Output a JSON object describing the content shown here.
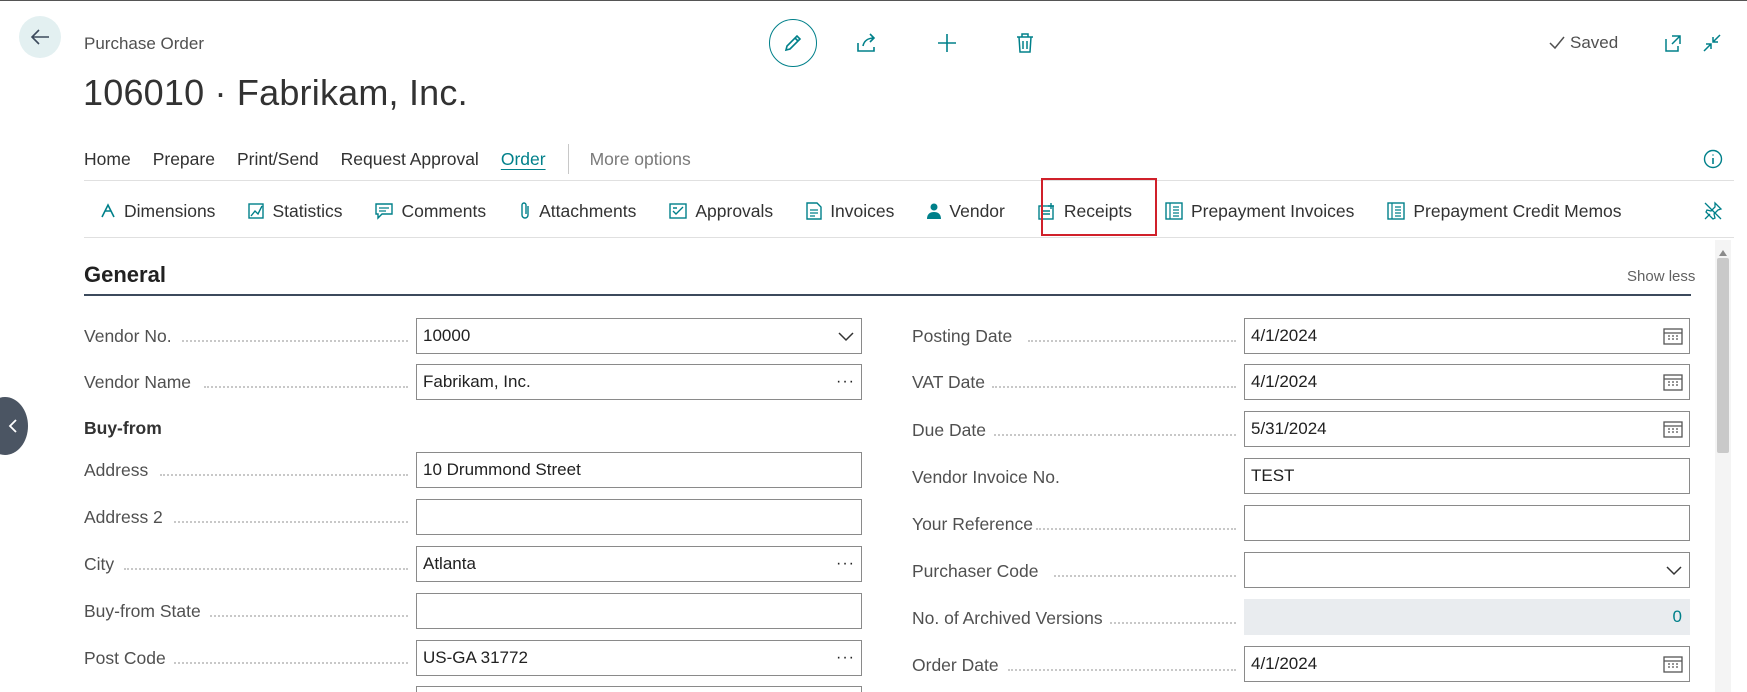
{
  "header": {
    "caption": "Purchase Order",
    "title": "106010 · Fabrikam, Inc.",
    "saved_label": "Saved"
  },
  "menu": {
    "items": [
      "Home",
      "Prepare",
      "Print/Send",
      "Request Approval",
      "Order"
    ],
    "more": "More options"
  },
  "promoted_actions": [
    {
      "label": "Dimensions",
      "icon": "dimensions-icon"
    },
    {
      "label": "Statistics",
      "icon": "statistics-icon"
    },
    {
      "label": "Comments",
      "icon": "comments-icon"
    },
    {
      "label": "Attachments",
      "icon": "paperclip-icon"
    },
    {
      "label": "Approvals",
      "icon": "approvals-icon"
    },
    {
      "label": "Invoices",
      "icon": "invoices-icon"
    },
    {
      "label": "Vendor",
      "icon": "vendor-icon"
    },
    {
      "label": "Receipts",
      "icon": "receipts-icon"
    },
    {
      "label": "Prepayment Invoices",
      "icon": "prepayment-invoices-icon"
    },
    {
      "label": "Prepayment Credit Memos",
      "icon": "prepayment-credit-memos-icon"
    }
  ],
  "general": {
    "title": "General",
    "show_less": "Show less",
    "buy_from_heading": "Buy-from",
    "left_fields": [
      {
        "label": "Vendor No.",
        "value": "10000"
      },
      {
        "label": "Vendor Name",
        "value": "Fabrikam, Inc."
      },
      {
        "label": "Address",
        "value": "10 Drummond Street"
      },
      {
        "label": "Address 2",
        "value": ""
      },
      {
        "label": "City",
        "value": "Atlanta"
      },
      {
        "label": "Buy-from State",
        "value": ""
      },
      {
        "label": "Post Code",
        "value": "US-GA 31772"
      }
    ],
    "right_fields": [
      {
        "label": "Posting Date",
        "value": "4/1/2024"
      },
      {
        "label": "VAT Date",
        "value": "4/1/2024"
      },
      {
        "label": "Due Date",
        "value": "5/31/2024"
      },
      {
        "label": "Vendor Invoice No.",
        "value": "TEST"
      },
      {
        "label": "Your Reference",
        "value": ""
      },
      {
        "label": "Purchaser Code",
        "value": ""
      },
      {
        "label": "No. of Archived Versions",
        "value": "0"
      },
      {
        "label": "Order Date",
        "value": "4/1/2024"
      }
    ]
  },
  "colors": {
    "accent": "#00808a",
    "highlight": "#d0202a"
  }
}
